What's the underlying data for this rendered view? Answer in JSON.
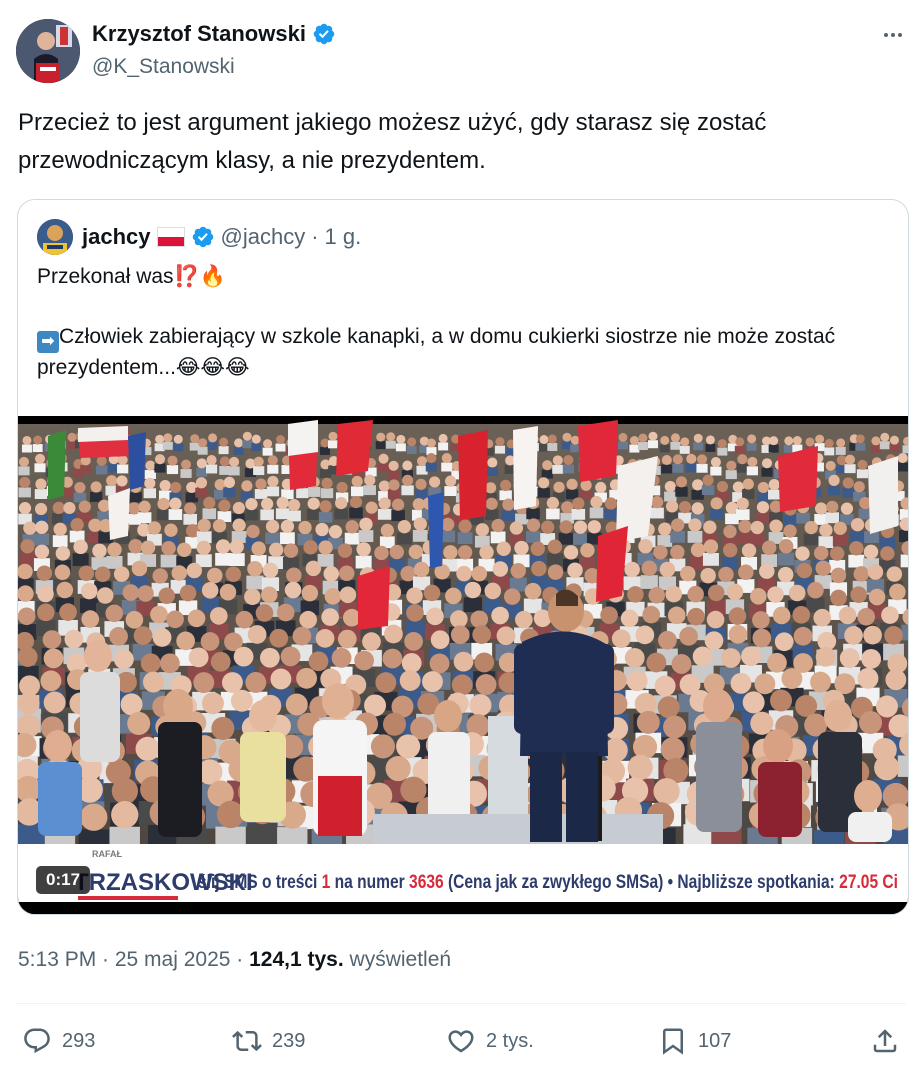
{
  "author": {
    "name": "Krzysztof Stanowski",
    "handle": "@K_Stanowski"
  },
  "tweet": {
    "text": "Przecież to jest argument jakiego możesz użyć, gdy starasz się zostać przewodniczącym klasy, a nie prezydentem."
  },
  "quote": {
    "name": "jachcy",
    "handle": "@jachcy",
    "separator": "·",
    "time": "1 g.",
    "line1": "Przekonał was⁉️🔥",
    "line2": "Człowiek zabierający w szkole kanapki, a w domu cukierki siostrze nie może zostać prezydentem...😂😂😂",
    "arrow_emoji": "➡",
    "video": {
      "duration": "0:17",
      "ticker_brand_small": "RAFAŁ",
      "ticker_brand": "TRZASKOWSKI",
      "ticker_text_a": "ślij SMS o treści ",
      "ticker_num_1": "1",
      "ticker_text_b": " na numer ",
      "ticker_num_2": "3636",
      "ticker_text_c": " (Cena jak za zwykłego SMSa) • Najbliższe spotkania: ",
      "ticker_num_3": "27.05 Ci"
    }
  },
  "meta": {
    "time": "5:13 PM · 25 maj 2025 · ",
    "views_count": "124,1 tys.",
    "views_label": " wyświetleń"
  },
  "actions": {
    "replies": "293",
    "reposts": "239",
    "likes": "2 tys.",
    "bookmarks": "107"
  },
  "colors": {
    "verified": "#1d9bf0",
    "text": "#0f1419",
    "muted": "#536471",
    "border": "#cfd9de"
  }
}
